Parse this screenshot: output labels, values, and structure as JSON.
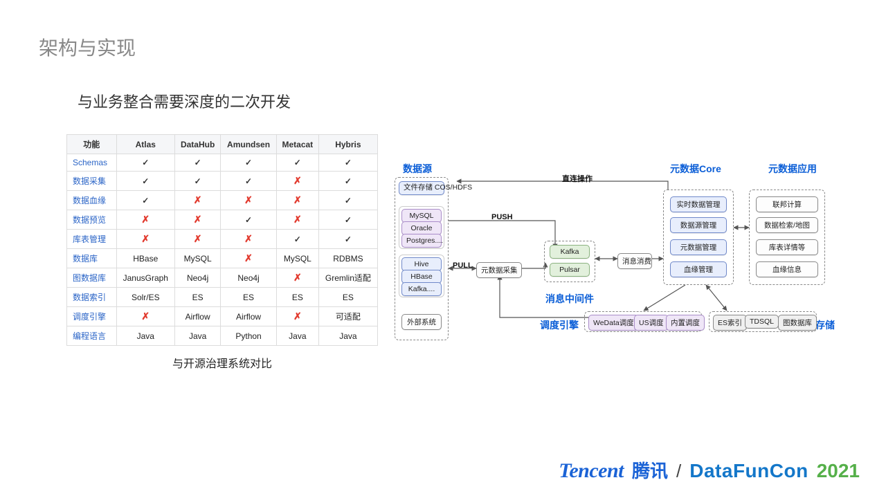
{
  "title": "架构与实现",
  "subtitle": "与业务整合需要深度的二次开发",
  "table": {
    "headers": [
      "功能",
      "Atlas",
      "DataHub",
      "Amundsen",
      "Metacat",
      "Hybris"
    ],
    "rows": [
      {
        "feature": "Schemas",
        "cells": [
          "✓",
          "✓",
          "✓",
          "✓",
          "✓"
        ]
      },
      {
        "feature": "数据采集",
        "cells": [
          "✓",
          "✓",
          "✓",
          "✗",
          "✓"
        ]
      },
      {
        "feature": "数据血缘",
        "cells": [
          "✓",
          "✗",
          "✗",
          "✗",
          "✓"
        ]
      },
      {
        "feature": "数据预览",
        "cells": [
          "✗",
          "✗",
          "✓",
          "✗",
          "✓"
        ]
      },
      {
        "feature": "库表管理",
        "cells": [
          "✗",
          "✗",
          "✗",
          "✓",
          "✓"
        ]
      },
      {
        "feature": "数据库",
        "cells": [
          "HBase",
          "MySQL",
          "✗",
          "MySQL",
          "RDBMS"
        ]
      },
      {
        "feature": "图数据库",
        "cells": [
          "JanusGraph",
          "Neo4j",
          "Neo4j",
          "✗",
          "Gremlin适配"
        ]
      },
      {
        "feature": "数据索引",
        "cells": [
          "Solr/ES",
          "ES",
          "ES",
          "ES",
          "ES"
        ]
      },
      {
        "feature": "调度引擎",
        "cells": [
          "✗",
          "Airflow",
          "Airflow",
          "✗",
          "可适配"
        ]
      },
      {
        "feature": "编程语言",
        "cells": [
          "Java",
          "Java",
          "Python",
          "Java",
          "Java"
        ]
      }
    ],
    "caption": "与开源治理系统对比"
  },
  "diagram": {
    "sections": {
      "data_source": "数据源",
      "core": "元数据Core",
      "app": "元数据应用",
      "mq": "消息中间件",
      "sched": "调度引擎",
      "store": "数据存储"
    },
    "nodes": {
      "file_store": "文件存储\nCOS/HDFS",
      "mysql": "MySQL",
      "oracle": "Oracle",
      "postgres": "Postgres....",
      "hive": "Hive",
      "hbase": "HBase",
      "kafka_src": "Kafka....",
      "ext": "外部系统",
      "collector": "元数据采集",
      "kafka": "Kafka",
      "pulsar": "Pulsar",
      "consume": "消息消费",
      "rt_mgr": "实时数据管理",
      "ds_mgr": "数据源管理",
      "meta_mgr": "元数据管理",
      "lineage": "血缘管理",
      "fed": "联邦计算",
      "search": "数据检索/地图",
      "detail": "库表详情等",
      "lineage_info": "血缘信息",
      "wedata": "WeData调度",
      "us": "US调度",
      "internal": "内置调度",
      "es": "ES索引",
      "tdsql": "TDSQL",
      "graphdb": "图数据库"
    },
    "anno": {
      "direct": "直连操作",
      "push": "PUSH",
      "pull": "PULL"
    }
  },
  "footer": {
    "tencent_en": "Tencent",
    "tencent_cn": "腾讯",
    "sep": "/",
    "dfc": "DataFunCon",
    "year": "2021"
  }
}
